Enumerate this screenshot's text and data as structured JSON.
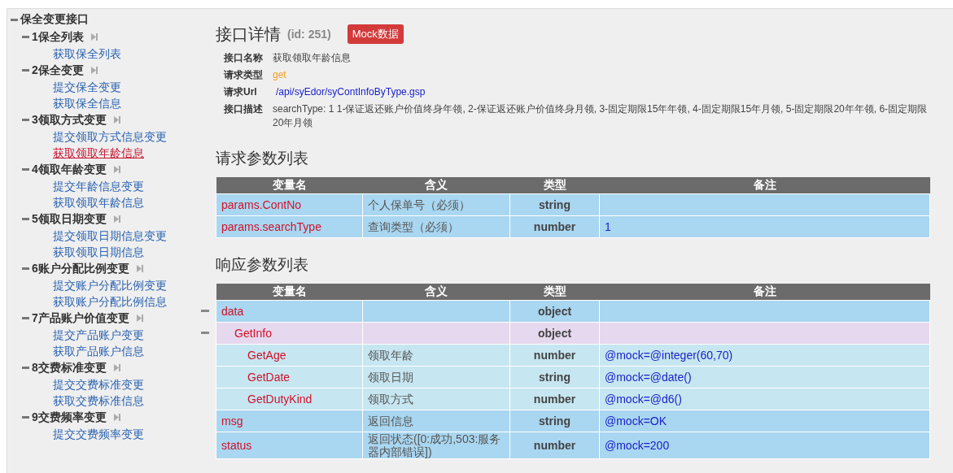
{
  "sidebar": {
    "root": {
      "label": "保全变更接口",
      "expanded": true,
      "children": [
        {
          "label": "1保全列表",
          "expanded": true,
          "children": [
            {
              "label": "获取保全列表",
              "selected": false
            }
          ]
        },
        {
          "label": "2保全变更",
          "expanded": true,
          "children": [
            {
              "label": "提交保全变更",
              "selected": false
            },
            {
              "label": "获取保全信息",
              "selected": false
            }
          ]
        },
        {
          "label": "3领取方式变更",
          "expanded": true,
          "children": [
            {
              "label": "提交领取方式信息变更",
              "selected": false
            },
            {
              "label": "获取领取年龄信息",
              "selected": true
            }
          ]
        },
        {
          "label": "4领取年龄变更",
          "expanded": true,
          "children": [
            {
              "label": "提交年龄信息变更",
              "selected": false
            },
            {
              "label": "获取领取年龄信息",
              "selected": false
            }
          ]
        },
        {
          "label": "5领取日期变更",
          "expanded": true,
          "children": [
            {
              "label": "提交领取日期信息变更",
              "selected": false
            },
            {
              "label": "获取领取日期信息",
              "selected": false
            }
          ]
        },
        {
          "label": "6账户分配比例变更",
          "expanded": true,
          "children": [
            {
              "label": "提交账户分配比例变更",
              "selected": false
            },
            {
              "label": "获取账户分配比例信息",
              "selected": false
            }
          ]
        },
        {
          "label": "7产品账户价值变更",
          "expanded": true,
          "children": [
            {
              "label": "提交产品账户变更",
              "selected": false
            },
            {
              "label": "获取产品账户信息",
              "selected": false
            }
          ]
        },
        {
          "label": "8交费标准变更",
          "expanded": true,
          "children": [
            {
              "label": "提交交费标准变更",
              "selected": false
            },
            {
              "label": "获取交费标准信息",
              "selected": false
            }
          ]
        },
        {
          "label": "9交费频率变更",
          "expanded": true,
          "children": [
            {
              "label": "提交交费频率变更",
              "selected": false
            }
          ]
        }
      ]
    }
  },
  "detail": {
    "title": "接口详情",
    "id_label": "(id: 251)",
    "mock_badge": "Mock数据",
    "fields": [
      {
        "label": "接口名称",
        "value": "获取领取年龄信息",
        "kind": "plain"
      },
      {
        "label": "请求类型",
        "value": "get",
        "kind": "method"
      },
      {
        "label": "请求Url",
        "value": "/api/syEdor/syContInfoByType.gsp",
        "kind": "url"
      },
      {
        "label": "接口描述",
        "value": "searchType: 1 1-保证返还账户价值终身年领, 2-保证返还账户价值终身月领, 3-固定期限15年年领, 4-固定期限15年月领, 5-固定期限20年年领, 6-固定期限20年月领",
        "kind": "plain"
      }
    ]
  },
  "request_params": {
    "title": "请求参数列表",
    "columns": [
      "变量名",
      "含义",
      "类型",
      "备注"
    ],
    "rows": [
      {
        "name": "params.ContNo",
        "meaning": "个人保单号（必须）",
        "type": "string"
      },
      {
        "name": "params.searchType",
        "meaning": "查询类型（必须）",
        "type": "number",
        "note": "1"
      }
    ]
  },
  "response_params": {
    "title": "响应参数列表",
    "columns": [
      "变量名",
      "含义",
      "类型",
      "备注"
    ],
    "rows": [
      {
        "name": "data",
        "type": "object",
        "expanded": true,
        "children": [
          {
            "name": "GetInfo",
            "type": "object",
            "expanded": true,
            "children": [
              {
                "name": "GetAge",
                "meaning": "领取年龄",
                "type": "number",
                "note": "@mock=@integer(60,70)"
              },
              {
                "name": "GetDate",
                "meaning": "领取日期",
                "type": "string",
                "note": "@mock=@date()"
              },
              {
                "name": "GetDutyKind",
                "meaning": "领取方式",
                "type": "number",
                "note": "@mock=@d6()"
              }
            ]
          }
        ]
      },
      {
        "name": "msg",
        "meaning": "返回信息",
        "type": "string",
        "note": "@mock=OK"
      },
      {
        "name": "status",
        "meaning": "返回状态([0:成功,503:服务器内部错误])",
        "type": "number",
        "note": "@mock=200"
      }
    ]
  }
}
